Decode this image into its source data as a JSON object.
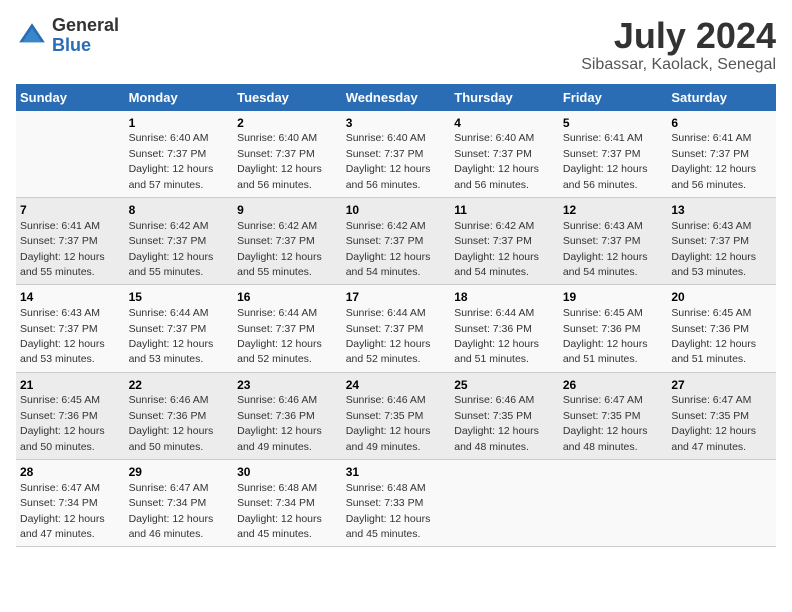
{
  "header": {
    "logo_general": "General",
    "logo_blue": "Blue",
    "title": "July 2024",
    "subtitle": "Sibassar, Kaolack, Senegal"
  },
  "calendar": {
    "weekdays": [
      "Sunday",
      "Monday",
      "Tuesday",
      "Wednesday",
      "Thursday",
      "Friday",
      "Saturday"
    ],
    "weeks": [
      [
        {
          "day": "",
          "sunrise": "",
          "sunset": "",
          "daylight": ""
        },
        {
          "day": "1",
          "sunrise": "Sunrise: 6:40 AM",
          "sunset": "Sunset: 7:37 PM",
          "daylight": "Daylight: 12 hours and 57 minutes."
        },
        {
          "day": "2",
          "sunrise": "Sunrise: 6:40 AM",
          "sunset": "Sunset: 7:37 PM",
          "daylight": "Daylight: 12 hours and 56 minutes."
        },
        {
          "day": "3",
          "sunrise": "Sunrise: 6:40 AM",
          "sunset": "Sunset: 7:37 PM",
          "daylight": "Daylight: 12 hours and 56 minutes."
        },
        {
          "day": "4",
          "sunrise": "Sunrise: 6:40 AM",
          "sunset": "Sunset: 7:37 PM",
          "daylight": "Daylight: 12 hours and 56 minutes."
        },
        {
          "day": "5",
          "sunrise": "Sunrise: 6:41 AM",
          "sunset": "Sunset: 7:37 PM",
          "daylight": "Daylight: 12 hours and 56 minutes."
        },
        {
          "day": "6",
          "sunrise": "Sunrise: 6:41 AM",
          "sunset": "Sunset: 7:37 PM",
          "daylight": "Daylight: 12 hours and 56 minutes."
        }
      ],
      [
        {
          "day": "7",
          "sunrise": "Sunrise: 6:41 AM",
          "sunset": "Sunset: 7:37 PM",
          "daylight": "Daylight: 12 hours and 55 minutes."
        },
        {
          "day": "8",
          "sunrise": "Sunrise: 6:42 AM",
          "sunset": "Sunset: 7:37 PM",
          "daylight": "Daylight: 12 hours and 55 minutes."
        },
        {
          "day": "9",
          "sunrise": "Sunrise: 6:42 AM",
          "sunset": "Sunset: 7:37 PM",
          "daylight": "Daylight: 12 hours and 55 minutes."
        },
        {
          "day": "10",
          "sunrise": "Sunrise: 6:42 AM",
          "sunset": "Sunset: 7:37 PM",
          "daylight": "Daylight: 12 hours and 54 minutes."
        },
        {
          "day": "11",
          "sunrise": "Sunrise: 6:42 AM",
          "sunset": "Sunset: 7:37 PM",
          "daylight": "Daylight: 12 hours and 54 minutes."
        },
        {
          "day": "12",
          "sunrise": "Sunrise: 6:43 AM",
          "sunset": "Sunset: 7:37 PM",
          "daylight": "Daylight: 12 hours and 54 minutes."
        },
        {
          "day": "13",
          "sunrise": "Sunrise: 6:43 AM",
          "sunset": "Sunset: 7:37 PM",
          "daylight": "Daylight: 12 hours and 53 minutes."
        }
      ],
      [
        {
          "day": "14",
          "sunrise": "Sunrise: 6:43 AM",
          "sunset": "Sunset: 7:37 PM",
          "daylight": "Daylight: 12 hours and 53 minutes."
        },
        {
          "day": "15",
          "sunrise": "Sunrise: 6:44 AM",
          "sunset": "Sunset: 7:37 PM",
          "daylight": "Daylight: 12 hours and 53 minutes."
        },
        {
          "day": "16",
          "sunrise": "Sunrise: 6:44 AM",
          "sunset": "Sunset: 7:37 PM",
          "daylight": "Daylight: 12 hours and 52 minutes."
        },
        {
          "day": "17",
          "sunrise": "Sunrise: 6:44 AM",
          "sunset": "Sunset: 7:37 PM",
          "daylight": "Daylight: 12 hours and 52 minutes."
        },
        {
          "day": "18",
          "sunrise": "Sunrise: 6:44 AM",
          "sunset": "Sunset: 7:36 PM",
          "daylight": "Daylight: 12 hours and 51 minutes."
        },
        {
          "day": "19",
          "sunrise": "Sunrise: 6:45 AM",
          "sunset": "Sunset: 7:36 PM",
          "daylight": "Daylight: 12 hours and 51 minutes."
        },
        {
          "day": "20",
          "sunrise": "Sunrise: 6:45 AM",
          "sunset": "Sunset: 7:36 PM",
          "daylight": "Daylight: 12 hours and 51 minutes."
        }
      ],
      [
        {
          "day": "21",
          "sunrise": "Sunrise: 6:45 AM",
          "sunset": "Sunset: 7:36 PM",
          "daylight": "Daylight: 12 hours and 50 minutes."
        },
        {
          "day": "22",
          "sunrise": "Sunrise: 6:46 AM",
          "sunset": "Sunset: 7:36 PM",
          "daylight": "Daylight: 12 hours and 50 minutes."
        },
        {
          "day": "23",
          "sunrise": "Sunrise: 6:46 AM",
          "sunset": "Sunset: 7:36 PM",
          "daylight": "Daylight: 12 hours and 49 minutes."
        },
        {
          "day": "24",
          "sunrise": "Sunrise: 6:46 AM",
          "sunset": "Sunset: 7:35 PM",
          "daylight": "Daylight: 12 hours and 49 minutes."
        },
        {
          "day": "25",
          "sunrise": "Sunrise: 6:46 AM",
          "sunset": "Sunset: 7:35 PM",
          "daylight": "Daylight: 12 hours and 48 minutes."
        },
        {
          "day": "26",
          "sunrise": "Sunrise: 6:47 AM",
          "sunset": "Sunset: 7:35 PM",
          "daylight": "Daylight: 12 hours and 48 minutes."
        },
        {
          "day": "27",
          "sunrise": "Sunrise: 6:47 AM",
          "sunset": "Sunset: 7:35 PM",
          "daylight": "Daylight: 12 hours and 47 minutes."
        }
      ],
      [
        {
          "day": "28",
          "sunrise": "Sunrise: 6:47 AM",
          "sunset": "Sunset: 7:34 PM",
          "daylight": "Daylight: 12 hours and 47 minutes."
        },
        {
          "day": "29",
          "sunrise": "Sunrise: 6:47 AM",
          "sunset": "Sunset: 7:34 PM",
          "daylight": "Daylight: 12 hours and 46 minutes."
        },
        {
          "day": "30",
          "sunrise": "Sunrise: 6:48 AM",
          "sunset": "Sunset: 7:34 PM",
          "daylight": "Daylight: 12 hours and 45 minutes."
        },
        {
          "day": "31",
          "sunrise": "Sunrise: 6:48 AM",
          "sunset": "Sunset: 7:33 PM",
          "daylight": "Daylight: 12 hours and 45 minutes."
        },
        {
          "day": "",
          "sunrise": "",
          "sunset": "",
          "daylight": ""
        },
        {
          "day": "",
          "sunrise": "",
          "sunset": "",
          "daylight": ""
        },
        {
          "day": "",
          "sunrise": "",
          "sunset": "",
          "daylight": ""
        }
      ]
    ]
  }
}
